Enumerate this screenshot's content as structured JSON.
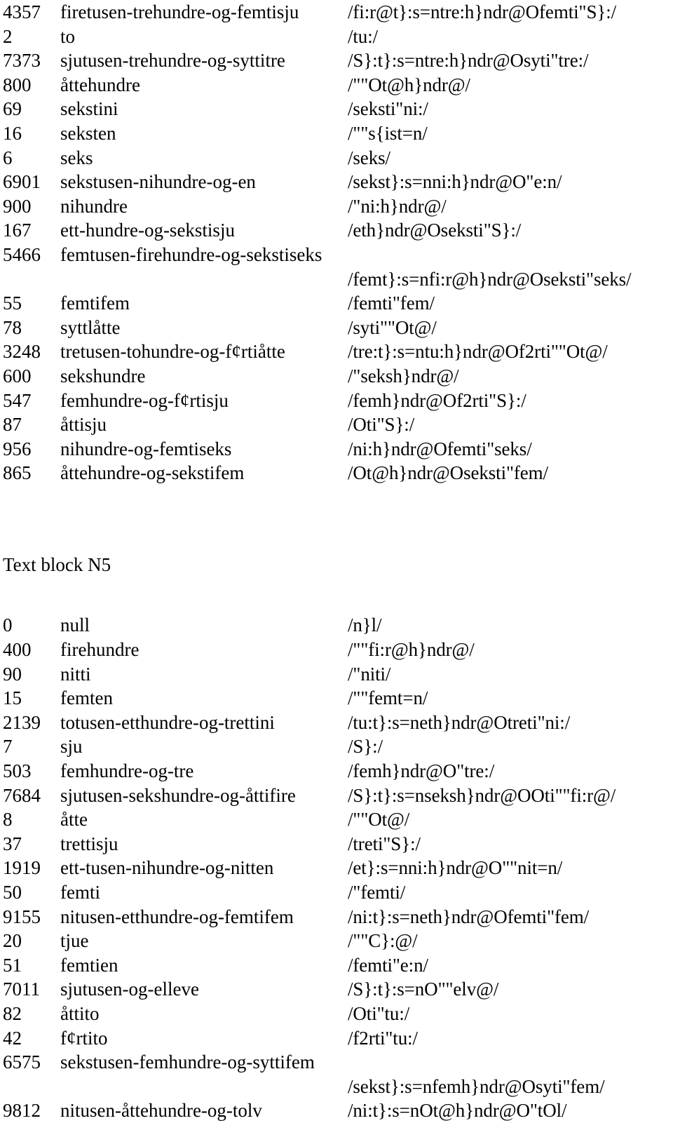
{
  "document": {
    "language_note": "Norwegian number words with phonetic transcriptions",
    "columns": [
      "number",
      "word",
      "phonetic"
    ],
    "blocks": [
      {
        "id": "block-continued",
        "heading": null,
        "rows": [
          {
            "number": "4357",
            "word": "firetusen-trehundre-og-femtisju",
            "phonetic": "/fi:r@t}:s=ntre:h}ndr@Ofemti\"S}:/",
            "wrapped": false
          },
          {
            "number": "2",
            "word": "to",
            "phonetic": "/tu:/",
            "wrapped": false
          },
          {
            "number": "7373",
            "word": "sjutusen-trehundre-og-syttitre",
            "phonetic": "/S}:t}:s=ntre:h}ndr@Osyti\"tre:/",
            "wrapped": false
          },
          {
            "number": "800",
            "word": "åttehundre",
            "phonetic": "/\"\"Ot@h}ndr@/",
            "wrapped": false
          },
          {
            "number": "69",
            "word": "sekstini",
            "phonetic": "/seksti\"ni:/",
            "wrapped": false
          },
          {
            "number": "16",
            "word": "seksten",
            "phonetic": "/\"\"s{ist=n/",
            "wrapped": false
          },
          {
            "number": "6",
            "word": "seks",
            "phonetic": "/seks/",
            "wrapped": false
          },
          {
            "number": "6901",
            "word": "sekstusen-nihundre-og-en",
            "phonetic": "/sekst}:s=nni:h}ndr@O\"e:n/",
            "wrapped": false
          },
          {
            "number": "900",
            "word": "nihundre",
            "phonetic": "/\"ni:h}ndr@/",
            "wrapped": false
          },
          {
            "number": "167",
            "word": "ett-hundre-og-sekstisju",
            "phonetic": "/eth}ndr@Oseksti\"S}:/",
            "wrapped": false
          },
          {
            "number": "5466",
            "word": "femtusen-firehundre-og-sekstiseks",
            "phonetic": "/femt}:s=nfi:r@h}ndr@Oseksti\"seks/",
            "wrapped": true
          },
          {
            "number": "55",
            "word": "femtifem",
            "phonetic": "/femti\"fem/",
            "wrapped": false
          },
          {
            "number": "78",
            "word": "syttlåtte",
            "phonetic": "/syti\"\"Ot@/",
            "wrapped": false
          },
          {
            "number": "3248",
            "word": "tretusen-tohundre-og-f¢rtiåtte",
            "phonetic": "/tre:t}:s=ntu:h}ndr@Of2rti\"\"Ot@/",
            "wrapped": false
          },
          {
            "number": "600",
            "word": "sekshundre",
            "phonetic": "/\"seksh}ndr@/",
            "wrapped": false
          },
          {
            "number": "547",
            "word": "femhundre-og-f¢rtisju",
            "phonetic": "/femh}ndr@Of2rti\"S}:/",
            "wrapped": false
          },
          {
            "number": "87",
            "word": "åttisju",
            "phonetic": "/Oti\"S}:/",
            "wrapped": false
          },
          {
            "number": "956",
            "word": "nihundre-og-femtiseks",
            "phonetic": "/ni:h}ndr@Ofemti\"seks/",
            "wrapped": false
          },
          {
            "number": "865",
            "word": "åttehundre-og-sekstifem",
            "phonetic": "/Ot@h}ndr@Oseksti\"fem/",
            "wrapped": false
          }
        ]
      },
      {
        "id": "block-n5",
        "heading": "Text block N5",
        "rows": [
          {
            "number": "0",
            "word": "null",
            "phonetic": "/n}l/",
            "wrapped": false
          },
          {
            "number": "400",
            "word": "firehundre",
            "phonetic": "/\"\"fi:r@h}ndr@/",
            "wrapped": false
          },
          {
            "number": "90",
            "word": "nitti",
            "phonetic": "/\"niti/",
            "wrapped": false
          },
          {
            "number": "15",
            "word": "femten",
            "phonetic": "/\"\"femt=n/",
            "wrapped": false
          },
          {
            "number": "2139",
            "word": "totusen-etthundre-og-trettini",
            "phonetic": "/tu:t}:s=neth}ndr@Otreti\"ni:/",
            "wrapped": false
          },
          {
            "number": "7",
            "word": "sju",
            "phonetic": "/S}:/",
            "wrapped": false
          },
          {
            "number": "503",
            "word": "femhundre-og-tre",
            "phonetic": "/femh}ndr@O\"tre:/",
            "wrapped": false
          },
          {
            "number": "7684",
            "word": "sjutusen-sekshundre-og-åttifire",
            "phonetic": "/S}:t}:s=nseksh}ndr@OOti\"\"fi:r@/",
            "wrapped": false
          },
          {
            "number": "8",
            "word": "åtte",
            "phonetic": "/\"\"Ot@/",
            "wrapped": false
          },
          {
            "number": "37",
            "word": "trettisju",
            "phonetic": "/treti\"S}:/",
            "wrapped": false
          },
          {
            "number": "1919",
            "word": "ett-tusen-nihundre-og-nitten",
            "phonetic": "/et}:s=nni:h}ndr@O\"\"nit=n/",
            "wrapped": false
          },
          {
            "number": "50",
            "word": "femti",
            "phonetic": "/\"femti/",
            "wrapped": false
          },
          {
            "number": "9155",
            "word": "nitusen-etthundre-og-femtifem",
            "phonetic": "/ni:t}:s=neth}ndr@Ofemti\"fem/",
            "wrapped": false
          },
          {
            "number": "20",
            "word": "tjue",
            "phonetic": "/\"\"C}:@/",
            "wrapped": false
          },
          {
            "number": "51",
            "word": "femtien",
            "phonetic": "/femti\"e:n/",
            "wrapped": false
          },
          {
            "number": "7011",
            "word": "sjutusen-og-elleve",
            "phonetic": "/S}:t}:s=nO\"\"elv@/",
            "wrapped": false
          },
          {
            "number": "82",
            "word": "åttito",
            "phonetic": "/Oti\"tu:/",
            "wrapped": false
          },
          {
            "number": "42",
            "word": "f¢rtito",
            "phonetic": "/f2rti\"tu:/",
            "wrapped": false
          },
          {
            "number": "6575",
            "word": "sekstusen-femhundre-og-syttifem",
            "phonetic": "/sekst}:s=nfemh}ndr@Osyti\"fem/",
            "wrapped": true
          },
          {
            "number": "9812",
            "word": "nitusen-åttehundre-og-tolv",
            "phonetic": "/ni:t}:s=nOt@h}ndr@O\"tOl/",
            "wrapped": false
          }
        ]
      }
    ]
  }
}
